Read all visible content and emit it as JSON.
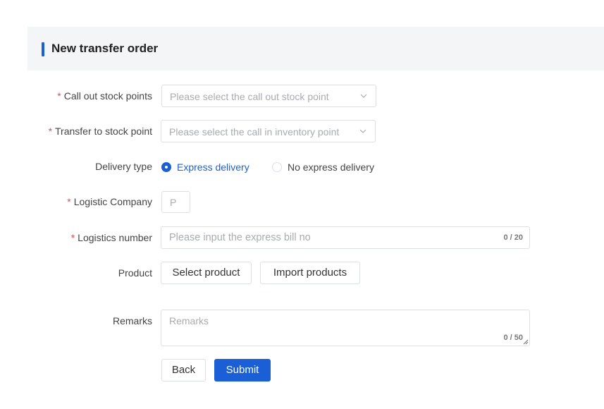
{
  "header": {
    "title": "New transfer order"
  },
  "form": {
    "call_out": {
      "label": "Call out stock points",
      "required_mark": "*",
      "placeholder": "Please select the call out stock point"
    },
    "transfer_to": {
      "label": "Transfer to stock point",
      "required_mark": "*",
      "placeholder": "Please select the call in inventory point"
    },
    "delivery_type": {
      "label": "Delivery type",
      "options": [
        {
          "label": "Express delivery",
          "selected": true
        },
        {
          "label": "No express delivery",
          "selected": false
        }
      ]
    },
    "logistic_company": {
      "label": "Logistic Company",
      "required_mark": "*",
      "placeholder": "P"
    },
    "logistics_number": {
      "label": "Logistics number",
      "required_mark": "*",
      "placeholder": "Please input the express bill no",
      "counter": "0 / 20"
    },
    "product": {
      "label": "Product",
      "select_button": "Select product",
      "import_button": "Import products"
    },
    "remarks": {
      "label": "Remarks",
      "placeholder": "Remarks",
      "counter": "0 / 50"
    }
  },
  "actions": {
    "back_label": "Back",
    "submit_label": "Submit"
  },
  "colors": {
    "accent": "#1a5fd6",
    "required": "#e34d4d",
    "header_bg": "#f4f5f7"
  }
}
